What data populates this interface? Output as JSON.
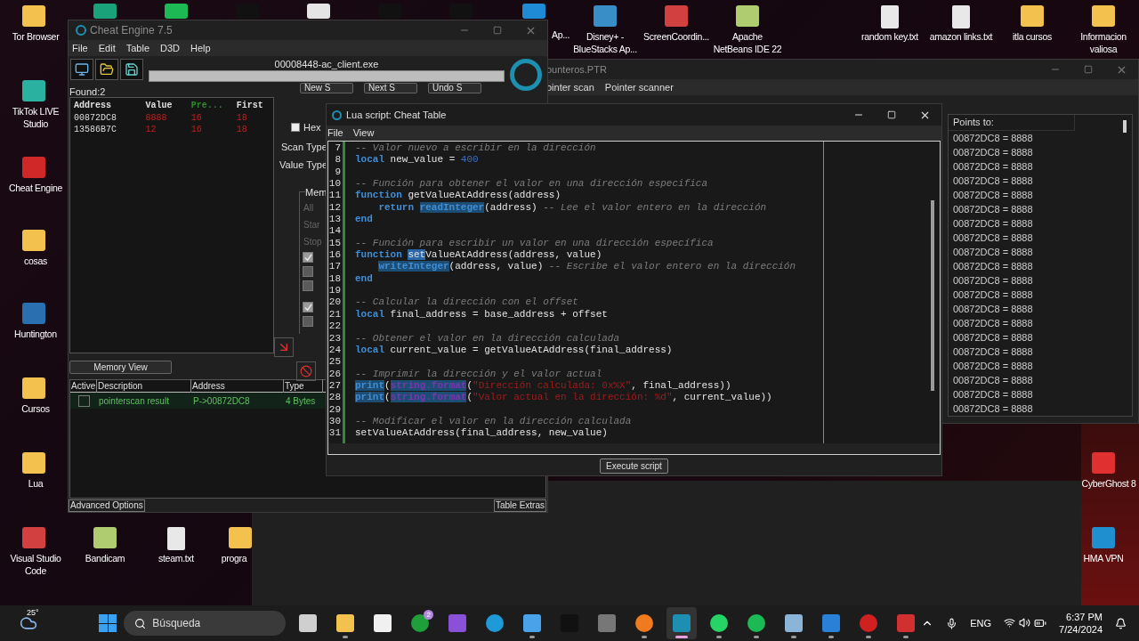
{
  "desktop_icons": [
    {
      "label": "Tor Browser"
    },
    {
      "label": "Ap..."
    },
    {
      "label": "Disney+ - BlueStacks Ap..."
    },
    {
      "label": "ScreenCoordin..."
    },
    {
      "label": "Apache NetBeans IDE 22"
    },
    {
      "label": "random key.txt"
    },
    {
      "label": "amazon links.txt"
    },
    {
      "label": "itla cursos"
    },
    {
      "label": "Informacion valiosa"
    },
    {
      "label": "TikTok LIVE Studio"
    },
    {
      "label": "Cheat Engine"
    },
    {
      "label": "cosas"
    },
    {
      "label": "Huntington"
    },
    {
      "label": "Cursos"
    },
    {
      "label": "Lua"
    },
    {
      "label": "Visual Studio Code"
    },
    {
      "label": "Bandicam"
    },
    {
      "label": "steam.txt"
    },
    {
      "label": "progra"
    },
    {
      "label": "CyberGhost 8"
    },
    {
      "label": "HMA VPN"
    }
  ],
  "pointer_window": {
    "title": "ounteros.PTR",
    "menu": [
      "ointer scan",
      "Pointer scanner"
    ],
    "column": "Points to:",
    "rows": [
      "00872DC8 = 8888",
      "00872DC8 = 8888",
      "00872DC8 = 8888",
      "00872DC8 = 8888",
      "00872DC8 = 8888",
      "00872DC8 = 8888",
      "00872DC8 = 8888",
      "00872DC8 = 8888",
      "00872DC8 = 8888",
      "00872DC8 = 8888",
      "00872DC8 = 8888",
      "00872DC8 = 8888",
      "00872DC8 = 8888",
      "00872DC8 = 8888",
      "00872DC8 = 8888",
      "00872DC8 = 8888",
      "00872DC8 = 8888",
      "00872DC8 = 8888",
      "00872DC8 = 8888",
      "00872DC8 = 8888"
    ]
  },
  "cheat_engine": {
    "title": "Cheat Engine 7.5",
    "menu": [
      "File",
      "Edit",
      "Table",
      "D3D",
      "Help"
    ],
    "process": "00008448-ac_client.exe",
    "progress": {
      "level": 0
    },
    "found": "Found:2",
    "results": {
      "columns": [
        "Address",
        "Value",
        "Pre...",
        "First"
      ],
      "rows": [
        [
          "00872DC8",
          "8888",
          "16",
          "18"
        ],
        [
          "13586B7C",
          "12",
          "16",
          "18"
        ]
      ]
    },
    "scan_buttons": [
      "New S",
      "Next S",
      "Undo S"
    ],
    "hex": {
      "label": "Hex",
      "checked": false
    },
    "scan_type": "Scan Type",
    "value_type": "Value Type",
    "memory_group": {
      "title": "Mem",
      "items": [
        "All",
        "Star",
        "Stop"
      ],
      "options": [
        {
          "checked": true
        },
        {
          "checked": false
        },
        {
          "checked": false
        },
        {
          "checked": true
        },
        {
          "checked": false
        }
      ]
    },
    "memory_view": "Memory View",
    "address_list": {
      "columns": [
        "Active",
        "Description",
        "Address",
        "Type"
      ],
      "rows": [
        {
          "active": false,
          "description": "pointerscan result",
          "address": "P->00872DC8",
          "type": "4 Bytes"
        }
      ]
    },
    "footer": [
      "Advanced Options",
      "Table Extras"
    ]
  },
  "lua_window": {
    "title": "Lua script: Cheat Table",
    "menu": [
      "File",
      "View"
    ],
    "button": "Execute script",
    "lines": [
      {
        "n": "7",
        "tokens": [
          {
            "kind": "comment",
            "text": "-- Valor nuevo a escribir en la dirección"
          }
        ]
      },
      {
        "n": "8",
        "tokens": [
          {
            "kind": "keyword",
            "text": "local"
          },
          {
            "kind": "plain",
            "text": " new_value = "
          },
          {
            "kind": "number",
            "text": "400"
          }
        ]
      },
      {
        "n": "9"
      },
      {
        "n": "10",
        "tokens": [
          {
            "kind": "comment",
            "text": "-- Función para obtener el valor en una dirección especifica"
          }
        ]
      },
      {
        "n": "11",
        "tokens": [
          {
            "kind": "keyword",
            "text": "function"
          },
          {
            "kind": "plain",
            "text": " getValueAtAddress(address)"
          }
        ]
      },
      {
        "n": "12",
        "indent": true,
        "tokens": [
          {
            "kind": "keyword",
            "text": "return "
          },
          {
            "kind": "builtin",
            "text": "readInteger"
          },
          {
            "kind": "plain",
            "text": "(address) "
          },
          {
            "kind": "comment",
            "text": "-- Lee el valor entero en la dirección"
          }
        ]
      },
      {
        "n": "13",
        "tokens": [
          {
            "kind": "keyword",
            "text": "end"
          }
        ]
      },
      {
        "n": "14"
      },
      {
        "n": "15",
        "tokens": [
          {
            "kind": "comment",
            "text": "-- Función para escribir un valor en una dirección específica"
          }
        ]
      },
      {
        "n": "16",
        "tokens": [
          {
            "kind": "keyword",
            "text": "function "
          },
          {
            "kind": "selected",
            "text": "set"
          },
          {
            "kind": "plain",
            "text": "ValueAtAddress(address, value)"
          }
        ]
      },
      {
        "n": "17",
        "indent": true,
        "tokens": [
          {
            "kind": "builtin",
            "text": "writeInteger"
          },
          {
            "kind": "plain",
            "text": "(address, value) "
          },
          {
            "kind": "comment",
            "text": "-- Escribe el valor entero en la dirección"
          }
        ]
      },
      {
        "n": "18",
        "tokens": [
          {
            "kind": "keyword",
            "text": "end"
          }
        ]
      },
      {
        "n": "19"
      },
      {
        "n": "20",
        "tokens": [
          {
            "kind": "comment",
            "text": "-- Calcular la dirección con el offset"
          }
        ]
      },
      {
        "n": "21",
        "tokens": [
          {
            "kind": "keyword",
            "text": "local"
          },
          {
            "kind": "plain",
            "text": " final_address = base_address + offset"
          }
        ]
      },
      {
        "n": "22"
      },
      {
        "n": "23",
        "tokens": [
          {
            "kind": "comment",
            "text": "-- Obtener el valor en la dirección calculada"
          }
        ]
      },
      {
        "n": "24",
        "tokens": [
          {
            "kind": "keyword",
            "text": "local"
          },
          {
            "kind": "plain",
            "text": " current_value = getValueAtAddress(final_address)"
          }
        ]
      },
      {
        "n": "25"
      },
      {
        "n": "26",
        "tokens": [
          {
            "kind": "comment",
            "text": "-- Imprimir la dirección y el valor actual"
          }
        ]
      },
      {
        "n": "27",
        "tokens": [
          {
            "kind": "builtin",
            "text": "print"
          },
          {
            "kind": "plain",
            "text": "("
          },
          {
            "kind": "library",
            "text": "string.format"
          },
          {
            "kind": "plain",
            "text": "("
          },
          {
            "kind": "string",
            "text": "\"Dirección calculada: 0x%X\""
          },
          {
            "kind": "plain",
            "text": ", final_address))"
          }
        ]
      },
      {
        "n": "28",
        "tokens": [
          {
            "kind": "builtin",
            "text": "print"
          },
          {
            "kind": "plain",
            "text": "("
          },
          {
            "kind": "library",
            "text": "string.format"
          },
          {
            "kind": "plain",
            "text": "("
          },
          {
            "kind": "string",
            "text": "\"Valor actual en la dirección: %d\""
          },
          {
            "kind": "plain",
            "text": ", current_value))"
          }
        ]
      },
      {
        "n": "29"
      },
      {
        "n": "30",
        "tokens": [
          {
            "kind": "comment",
            "text": "-- Modificar el valor en la dirección calculada"
          }
        ]
      },
      {
        "n": "31",
        "tokens": [
          {
            "kind": "plain",
            "text": "setValueAtAddress(final_address, new_value)"
          }
        ]
      }
    ]
  },
  "taskbar": {
    "weather": "25°",
    "search_placeholder": "Búsqueda",
    "apps": [
      {
        "running": false,
        "selected": false
      },
      {
        "running": true,
        "selected": false
      },
      {
        "running": false,
        "selected": false
      },
      {
        "running": false,
        "selected": false,
        "badge": "2"
      },
      {
        "running": false,
        "selected": false
      },
      {
        "running": false,
        "selected": false
      },
      {
        "running": true,
        "selected": false
      },
      {
        "running": false,
        "selected": false
      },
      {
        "running": false,
        "selected": false
      },
      {
        "running": true,
        "selected": false
      },
      {
        "running": true,
        "selected": true
      },
      {
        "running": true,
        "selected": false
      },
      {
        "running": true,
        "selected": false
      },
      {
        "running": true,
        "selected": false
      },
      {
        "running": true,
        "selected": false
      },
      {
        "running": true,
        "selected": false
      },
      {
        "running": true,
        "selected": false
      }
    ],
    "language": "ENG",
    "time": "6:37 PM",
    "date": "7/24/2024"
  }
}
